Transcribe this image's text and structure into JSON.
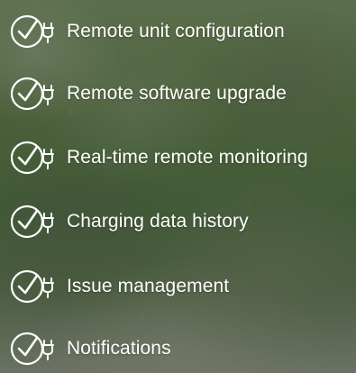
{
  "theme": {
    "text_color": "#ffffff",
    "icon_color": "#ffffff"
  },
  "features": [
    {
      "label": "Remote unit configuration",
      "icon": "check-circle-plug-icon"
    },
    {
      "label": "Remote software upgrade",
      "icon": "check-circle-plug-icon"
    },
    {
      "label": "Real-time remote monitoring",
      "icon": "check-circle-plug-icon"
    },
    {
      "label": "Charging data history",
      "icon": "check-circle-plug-icon"
    },
    {
      "label": "Issue management",
      "icon": "check-circle-plug-icon"
    },
    {
      "label": "Notifications",
      "icon": "check-circle-plug-icon"
    }
  ]
}
